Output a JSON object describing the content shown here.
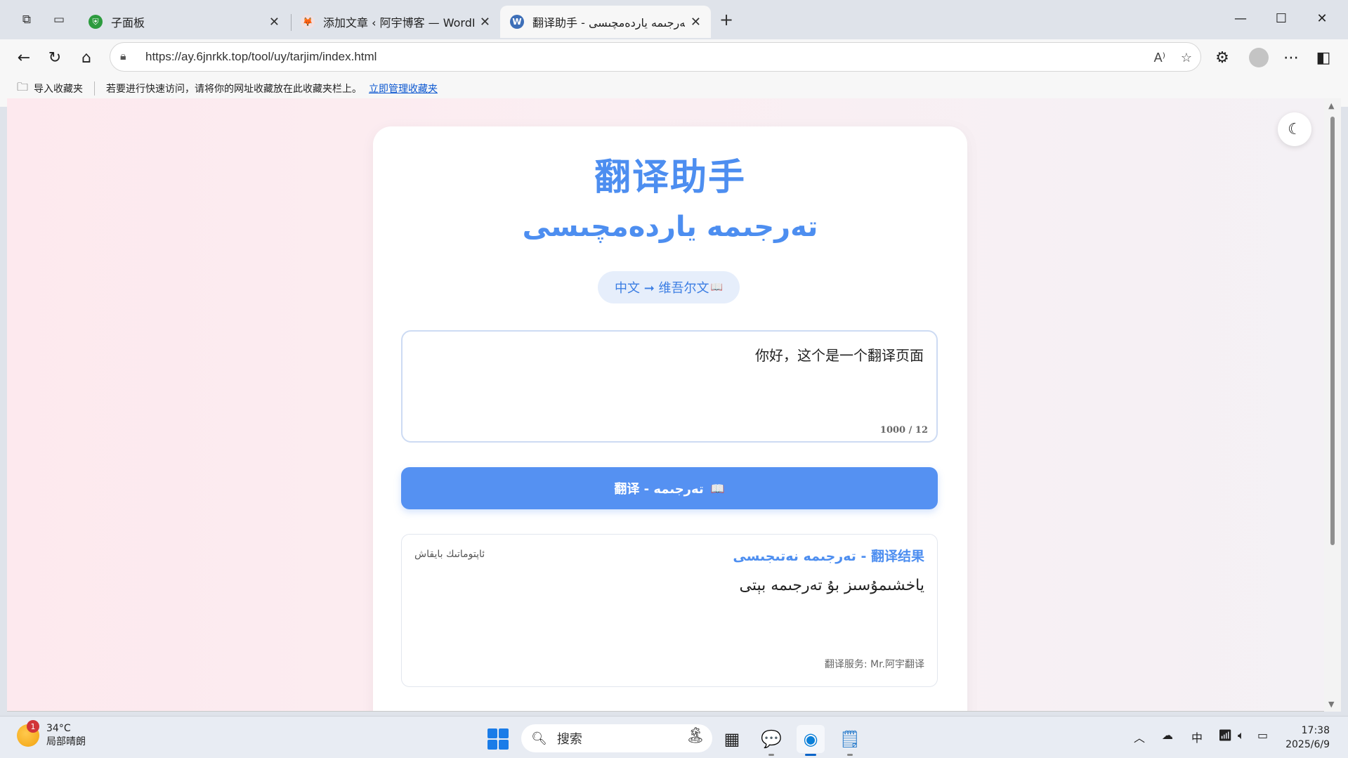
{
  "browser": {
    "tabs": [
      {
        "label": "子面板",
        "favicon": "shield-icon"
      },
      {
        "label": "添加文章 ‹ 阿宇博客 — WordPress",
        "favicon": "fox-icon"
      },
      {
        "label": "翻译助手 - تەرجىمە ياردەمچىسى",
        "favicon": "wordpress-icon"
      }
    ],
    "url": "https://ay.6jnrkk.top/tool/uy/tarjim/index.html",
    "favorites_bar": {
      "import_label": "导入收藏夹",
      "hint": "若要进行快速访问，请将你的网址收藏放在此收藏夹栏上。",
      "manage_link": "立即管理收藏夹"
    }
  },
  "page": {
    "title_cn": "翻译助手",
    "title_ug": "تەرجىمە ياردەمچىسى",
    "direction_label": "中文 ➞ 维吾尔文",
    "input_text": "你好，这个是一个翻译页面",
    "char_count": "1000 / 12",
    "translate_button": "翻译 - تەرجىمە",
    "result": {
      "auto_label": "ئاپتوماتىك بايقاش",
      "heading": "翻译结果 - تەرجىمە نەتىجىسى",
      "text": "ياخشىمۇسىز بۇ تەرجىمە بېتى",
      "service": "翻译服务: Mr.阿宇翻译"
    }
  },
  "taskbar": {
    "weather_temp": "34°C",
    "weather_desc": "局部晴朗",
    "weather_badge": "1",
    "search_placeholder": "搜索",
    "ime": "中",
    "time": "17:38",
    "date": "2025/6/9"
  },
  "colors": {
    "accent": "#4d8ef0",
    "button": "#5591f2",
    "pill_bg": "#e6eefb",
    "page_bg": "#fde9ee"
  }
}
